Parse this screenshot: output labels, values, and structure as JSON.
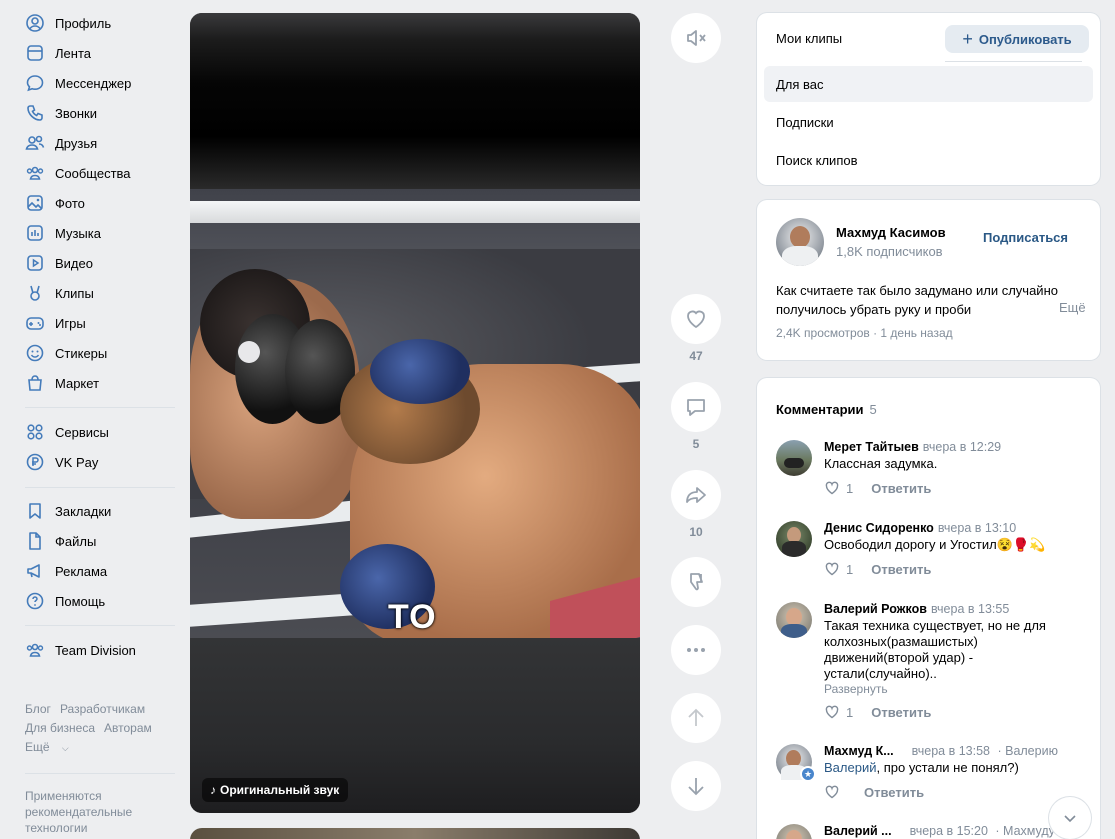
{
  "nav": {
    "items": [
      {
        "label": "Профиль",
        "icon": "profile-icon"
      },
      {
        "label": "Лента",
        "icon": "feed-icon"
      },
      {
        "label": "Мессенджер",
        "icon": "messenger-icon"
      },
      {
        "label": "Звонки",
        "icon": "phone-icon"
      },
      {
        "label": "Друзья",
        "icon": "friends-icon"
      },
      {
        "label": "Сообщества",
        "icon": "communities-icon"
      },
      {
        "label": "Фото",
        "icon": "photo-icon"
      },
      {
        "label": "Музыка",
        "icon": "music-icon"
      },
      {
        "label": "Видео",
        "icon": "video-icon"
      },
      {
        "label": "Клипы",
        "icon": "clips-icon"
      },
      {
        "label": "Игры",
        "icon": "games-icon"
      },
      {
        "label": "Стикеры",
        "icon": "stickers-icon"
      },
      {
        "label": "Маркет",
        "icon": "market-icon"
      }
    ],
    "items2": [
      {
        "label": "Сервисы",
        "icon": "services-icon"
      },
      {
        "label": "VK Pay",
        "icon": "vkpay-icon"
      }
    ],
    "items3": [
      {
        "label": "Закладки",
        "icon": "bookmark-icon"
      },
      {
        "label": "Файлы",
        "icon": "file-icon"
      },
      {
        "label": "Реклама",
        "icon": "ads-icon"
      },
      {
        "label": "Помощь",
        "icon": "help-icon"
      }
    ],
    "items4": [
      {
        "label": "Team Division",
        "icon": "group-icon"
      }
    ],
    "footer": {
      "blog": "Блог",
      "developers": "Разработчикам",
      "business": "Для бизнеса",
      "authors": "Авторам",
      "more": "Ещё"
    },
    "rec_note": "Применяются рекомендательные технологии"
  },
  "video": {
    "caption": "TO",
    "sound_label": "Оригинальный звук"
  },
  "actions": {
    "likes": "47",
    "comments": "5",
    "shares": "10"
  },
  "tabs": {
    "title": "Мои клипы",
    "publish": "Опубликовать",
    "items": [
      "Для вас",
      "Подписки",
      "Поиск клипов"
    ],
    "active": 0
  },
  "author": {
    "name": "Махмуд Касимов",
    "subscribers": "1,8K подписчиков",
    "subscribe": "Подписаться",
    "desc_main": "Как считаете так было задумано или случайно получилось убрать руку и проби",
    "desc_fade": "",
    "more": "Ещё",
    "views": "2,4K просмотров · 1 день назад"
  },
  "comments": {
    "title": "Комментарии",
    "count": "5",
    "reply_label": "Ответить",
    "expand_label": "Развернуть",
    "list": [
      {
        "name": "Мерет Тайтыев",
        "time": "вчера в 12:29",
        "text": "Классная задумка.",
        "likes": "1"
      },
      {
        "name": "Денис Сидоренко",
        "time": "вчера в 13:10",
        "text": "Освободил дорогу и Угостил😵🥊💫",
        "likes": "1"
      },
      {
        "name": "Валерий Рожков",
        "time": "вчера в 13:55",
        "text": "Такая техника существует, но не для колхозных(размашистых) движений(второй удар) - устали(случайно)..",
        "likes": "1"
      },
      {
        "name": "Махмуд К...",
        "time": "вчера в 13:58",
        "to": "· Валерию",
        "mention": "Валерий",
        "text": ", про устали не понял?)",
        "likes": ""
      },
      {
        "name": "Валерий ...",
        "time": "вчера в 15:20",
        "to": "· Махмуду",
        "text": "",
        "likes": ""
      }
    ]
  },
  "colors": {
    "accent": "#2a5885",
    "nav_icon": "#447bba",
    "muted": "#818c99",
    "background": "#edeef0"
  }
}
